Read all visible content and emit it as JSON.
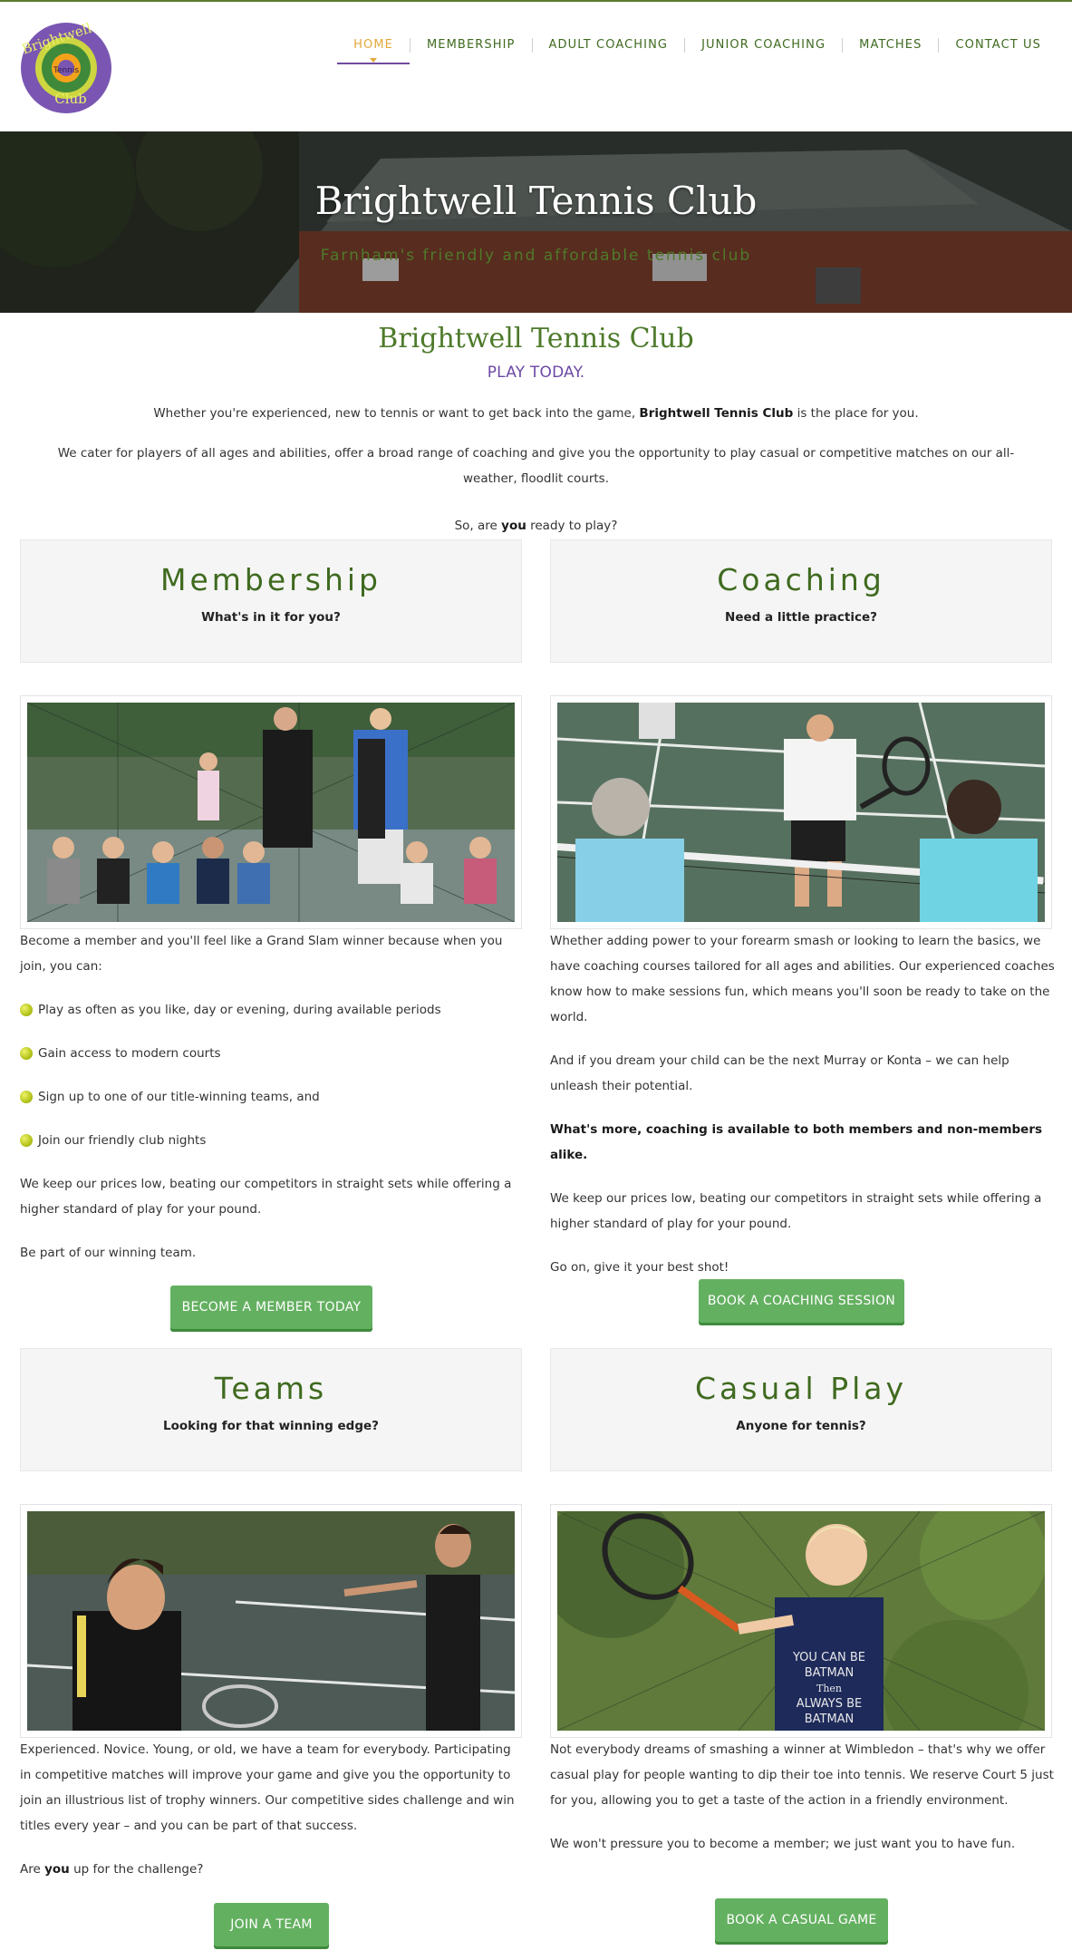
{
  "header": {
    "logo_alt": "Brightwell Tennis Club logo",
    "logo_text": [
      "Brightwell",
      "Tennis",
      "Club"
    ],
    "nav": [
      {
        "label": "HOME",
        "active": true
      },
      {
        "label": "MEMBERSHIP",
        "active": false
      },
      {
        "label": "ADULT COACHING",
        "active": false
      },
      {
        "label": "JUNIOR COACHING",
        "active": false
      },
      {
        "label": "MATCHES",
        "active": false
      },
      {
        "label": "CONTACT US",
        "active": false
      }
    ]
  },
  "hero": {
    "title": "Brightwell Tennis Club",
    "subtitle": "Farnham's friendly and affordable tennis club"
  },
  "intro": {
    "title": "Brightwell Tennis Club",
    "tagline": "PLAY TODAY.",
    "p1_before": "Whether you're experienced, new to tennis or want to get back into the game, ",
    "p1_bold": "Brightwell Tennis Club",
    "p1_after": " is the place for you.",
    "p2": "We cater for players of all ages and abilities, offer a broad range of coaching and give you the opportunity to play casual or competitive matches on our all-weather, floodlit courts.",
    "p3_before": "So, are ",
    "p3_bold": "you",
    "p3_after": " ready to play?"
  },
  "sections": {
    "membership": {
      "heading": "Membership",
      "sub": "What's in it for you?",
      "intro": "Become a member and you'll feel like a Grand Slam winner because when you join, you can:",
      "bullets": [
        "Play as often as you like, day or evening, during available periods",
        "Gain access to modern courts",
        "Sign up to one of our title-winning teams, and",
        "Join our friendly club nights"
      ],
      "p2": "We keep our prices low, beating our competitors in straight sets while offering a higher standard of play for your pound.",
      "p3": "Be part of our winning team.",
      "button": "BECOME A MEMBER TODAY"
    },
    "coaching": {
      "heading": "Coaching",
      "sub": "Need a little practice?",
      "p1": "Whether adding power to your forearm smash or looking to learn the basics, we have coaching courses tailored for all ages and abilities. Our experienced coaches know how to make sessions fun, which means you'll soon be ready to take on the world.",
      "p2": "And if you dream your child can be the next Murray or Konta – we can help unleash their potential.",
      "p3": "What's more, coaching is available to both members and non-members alike.",
      "p4": "We keep our prices low, beating our competitors in straight sets while offering a higher standard of play for your pound.",
      "p5": "Go on, give it your best shot!",
      "button": "BOOK A COACHING SESSION"
    },
    "teams": {
      "heading": "Teams",
      "sub": "Looking for that winning edge?",
      "p1": "Experienced. Novice. Young, or old, we have a team for everybody. Participating in competitive matches will improve your game and give you the opportunity to join an illustrious list of trophy winners. Our competitive sides challenge and win titles every year – and you can be part of that success.",
      "p2_before": "Are ",
      "p2_bold": "you",
      "p2_after": " up for the challenge?",
      "button": "JOIN A TEAM"
    },
    "casual": {
      "heading": "Casual Play",
      "sub": "Anyone for tennis?",
      "p1": "Not everybody dreams of smashing a winner at Wimbledon – that's why we offer casual play for people wanting to dip their toe into tennis. We reserve Court 5 just for you, allowing you to get a taste of the action in a friendly environment.",
      "p2": "We won't pressure you to become a member; we just want you to have fun.",
      "button": "BOOK A CASUAL GAME",
      "shirt_text": [
        "YOU CAN BE",
        "BATMAN",
        "Then",
        "ALWAYS BE",
        "BATMAN"
      ]
    }
  },
  "colors": {
    "brand_green": "#4d7a2a",
    "nav_green": "#3f6a1f",
    "accent_orange": "#e3a93a",
    "purple": "#6c49a5",
    "button_green": "#64b061"
  },
  "icons": [
    "tennis-ball-icon",
    "logo-icon"
  ]
}
